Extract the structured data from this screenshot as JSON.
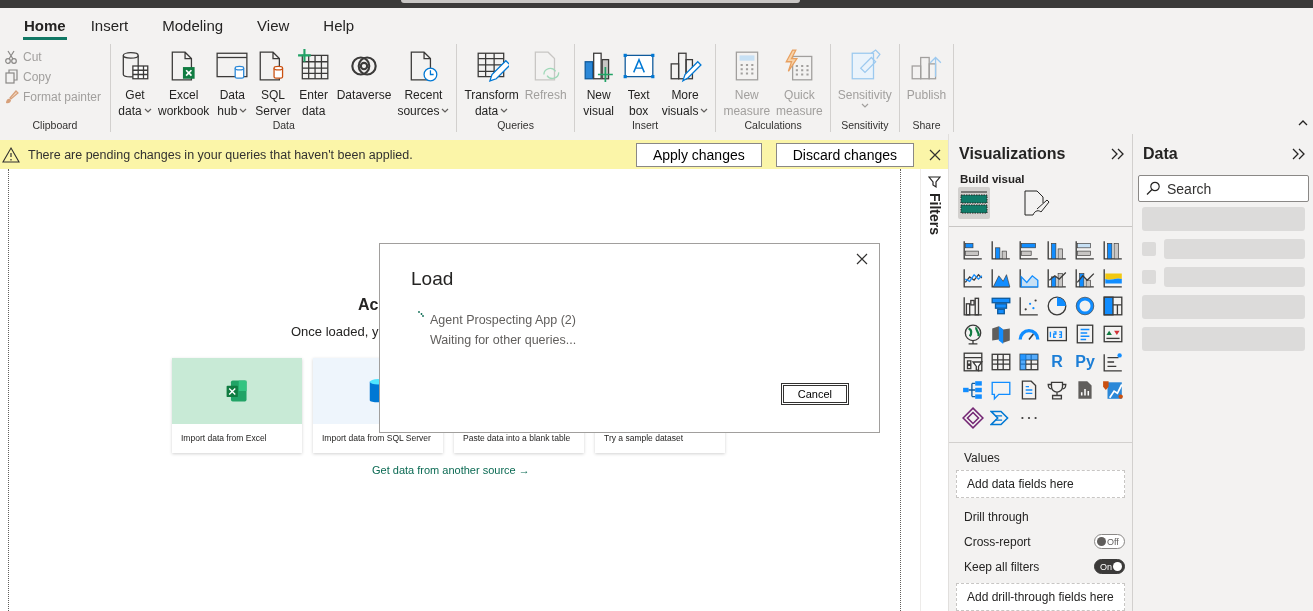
{
  "tabs": [
    {
      "label": "Home",
      "selected": true
    },
    {
      "label": "Insert",
      "selected": false
    },
    {
      "label": "Modeling",
      "selected": false
    },
    {
      "label": "View",
      "selected": false
    },
    {
      "label": "Help",
      "selected": false
    }
  ],
  "ribbon": {
    "groups": [
      {
        "label": "Clipboard",
        "kind": "small",
        "items": [
          {
            "lines": [
              "Cut"
            ],
            "disabled": true
          },
          {
            "lines": [
              "Copy"
            ],
            "disabled": true
          },
          {
            "lines": [
              "Format painter"
            ],
            "disabled": true
          }
        ]
      },
      {
        "label": "Data",
        "kind": "large",
        "items": [
          {
            "lines": [
              "Get",
              "data"
            ],
            "disabled": false,
            "dropdown": true
          },
          {
            "lines": [
              "Excel",
              "workbook"
            ],
            "disabled": false,
            "dropdown": false
          },
          {
            "lines": [
              "Data",
              "hub"
            ],
            "disabled": false,
            "dropdown": true
          },
          {
            "lines": [
              "SQL",
              "Server"
            ],
            "disabled": false,
            "dropdown": false
          },
          {
            "lines": [
              "Enter",
              "data"
            ],
            "disabled": false,
            "dropdown": false
          },
          {
            "lines": [
              "Dataverse"
            ],
            "disabled": false,
            "dropdown": false
          },
          {
            "lines": [
              "Recent",
              "sources"
            ],
            "disabled": false,
            "dropdown": true
          }
        ]
      },
      {
        "label": "Queries",
        "kind": "large",
        "items": [
          {
            "lines": [
              "Transform",
              "data"
            ],
            "disabled": false,
            "dropdown": true
          },
          {
            "lines": [
              "Refresh"
            ],
            "disabled": true,
            "dropdown": false
          }
        ]
      },
      {
        "label": "Insert",
        "kind": "large",
        "items": [
          {
            "lines": [
              "New",
              "visual"
            ],
            "disabled": false,
            "dropdown": false
          },
          {
            "lines": [
              "Text",
              "box"
            ],
            "disabled": false,
            "dropdown": false
          },
          {
            "lines": [
              "More",
              "visuals"
            ],
            "disabled": false,
            "dropdown": true
          }
        ]
      },
      {
        "label": "Calculations",
        "kind": "large",
        "items": [
          {
            "lines": [
              "New",
              "measure"
            ],
            "disabled": true,
            "dropdown": false
          },
          {
            "lines": [
              "Quick",
              "measure"
            ],
            "disabled": true,
            "dropdown": false
          }
        ]
      },
      {
        "label": "Sensitivity",
        "kind": "large",
        "items": [
          {
            "lines": [
              "Sensitivity"
            ],
            "disabled": true,
            "dropdown": true
          }
        ]
      },
      {
        "label": "Share",
        "kind": "large",
        "items": [
          {
            "lines": [
              "Publish"
            ],
            "disabled": true,
            "dropdown": false
          }
        ]
      }
    ]
  },
  "notification": {
    "message": "There are pending changes in your queries that haven't been applied.",
    "buttons": [
      "Apply changes",
      "Discard changes"
    ]
  },
  "canvas": {
    "heading": "Ac",
    "subtitle": "Once loaded, y",
    "cards": [
      {
        "label": "Import data from Excel"
      },
      {
        "label": "Import data from SQL Server"
      },
      {
        "label": "Paste data into a blank table"
      },
      {
        "label": "Try a sample dataset"
      }
    ],
    "link": "Get data from another source →"
  },
  "filters_pane": {
    "label": "Filters"
  },
  "visualizations": {
    "title": "Visualizations",
    "build_label": "Build visual",
    "view_modes": [
      {
        "selected": true
      },
      {
        "selected": false
      }
    ],
    "text_icons": [
      "R",
      "Py"
    ],
    "values_label": "Values",
    "values_well": "Add data fields here",
    "drill_label": "Drill through",
    "toggles": [
      {
        "label": "Cross-report",
        "on": false,
        "state_text": "Off"
      },
      {
        "label": "Keep all filters",
        "on": true,
        "state_text": "On"
      }
    ],
    "drill_well": "Add drill-through fields here"
  },
  "data_pane": {
    "title": "Data",
    "search": {
      "placeholder": "Search"
    }
  },
  "dialog": {
    "title": "Load",
    "item": "Agent Prospecting App (2)",
    "status": "Waiting for other queries...",
    "buttons": [
      "Cancel"
    ]
  }
}
